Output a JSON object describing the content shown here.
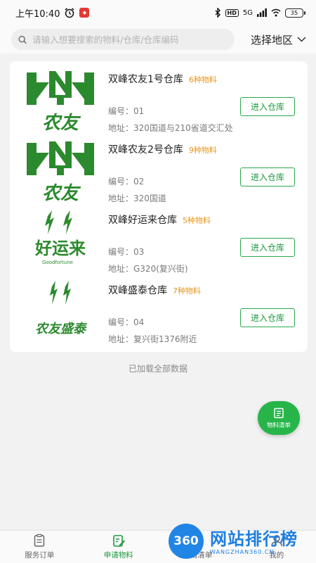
{
  "status": {
    "time": "上午10:40",
    "hd": "HD",
    "network": "5G",
    "battery": "35"
  },
  "search": {
    "placeholder": "请输入想要搜索的物料/仓库/仓库编码",
    "region_label": "选择地区"
  },
  "warehouses": [
    {
      "name": "双峰农友1号仓库",
      "count": "6种物料",
      "code": "编号：01",
      "address": "地址：320国道与210省道交汇处",
      "button": "进入仓库",
      "logo": "nongyou"
    },
    {
      "name": "双峰农友2号仓库",
      "count": "9种物料",
      "code": "编号：02",
      "address": "地址：320国道",
      "button": "进入仓库",
      "logo": "nongyou"
    },
    {
      "name": "双峰好运来仓库",
      "count": "5种物料",
      "code": "编号：03",
      "address": "地址：G320(复兴街)",
      "button": "进入仓库",
      "logo": "haoyunlai"
    },
    {
      "name": "双峰盛泰仓库",
      "count": "7种物料",
      "code": "编号：04",
      "address": "地址：复兴街1376附近",
      "button": "进入仓库",
      "logo": "nongyoushengtai"
    }
  ],
  "logos": {
    "nongyou": "农友",
    "haoyunlai": "好运来",
    "haoyunlai_en": "Goodfortune",
    "nongyoushengtai": "农友盛泰"
  },
  "loaded_text": "已加载全部数据",
  "fab_label": "物料清单",
  "tabs": [
    {
      "label": "服务订单",
      "icon": "clipboard-icon"
    },
    {
      "label": "申请物料",
      "icon": "edit-form-icon"
    },
    {
      "label": "申请清单",
      "icon": "list-icon"
    },
    {
      "label": "我的",
      "icon": "user-icon"
    }
  ],
  "watermark": {
    "badge": "360",
    "title": "网站排行榜",
    "url": "WANGZHAN360.CN"
  },
  "colors": {
    "primary_green": "#1f9a3f",
    "logo_green": "#2c8a2e",
    "count_orange": "#e6961f",
    "watermark_blue": "#1f7fe0"
  }
}
